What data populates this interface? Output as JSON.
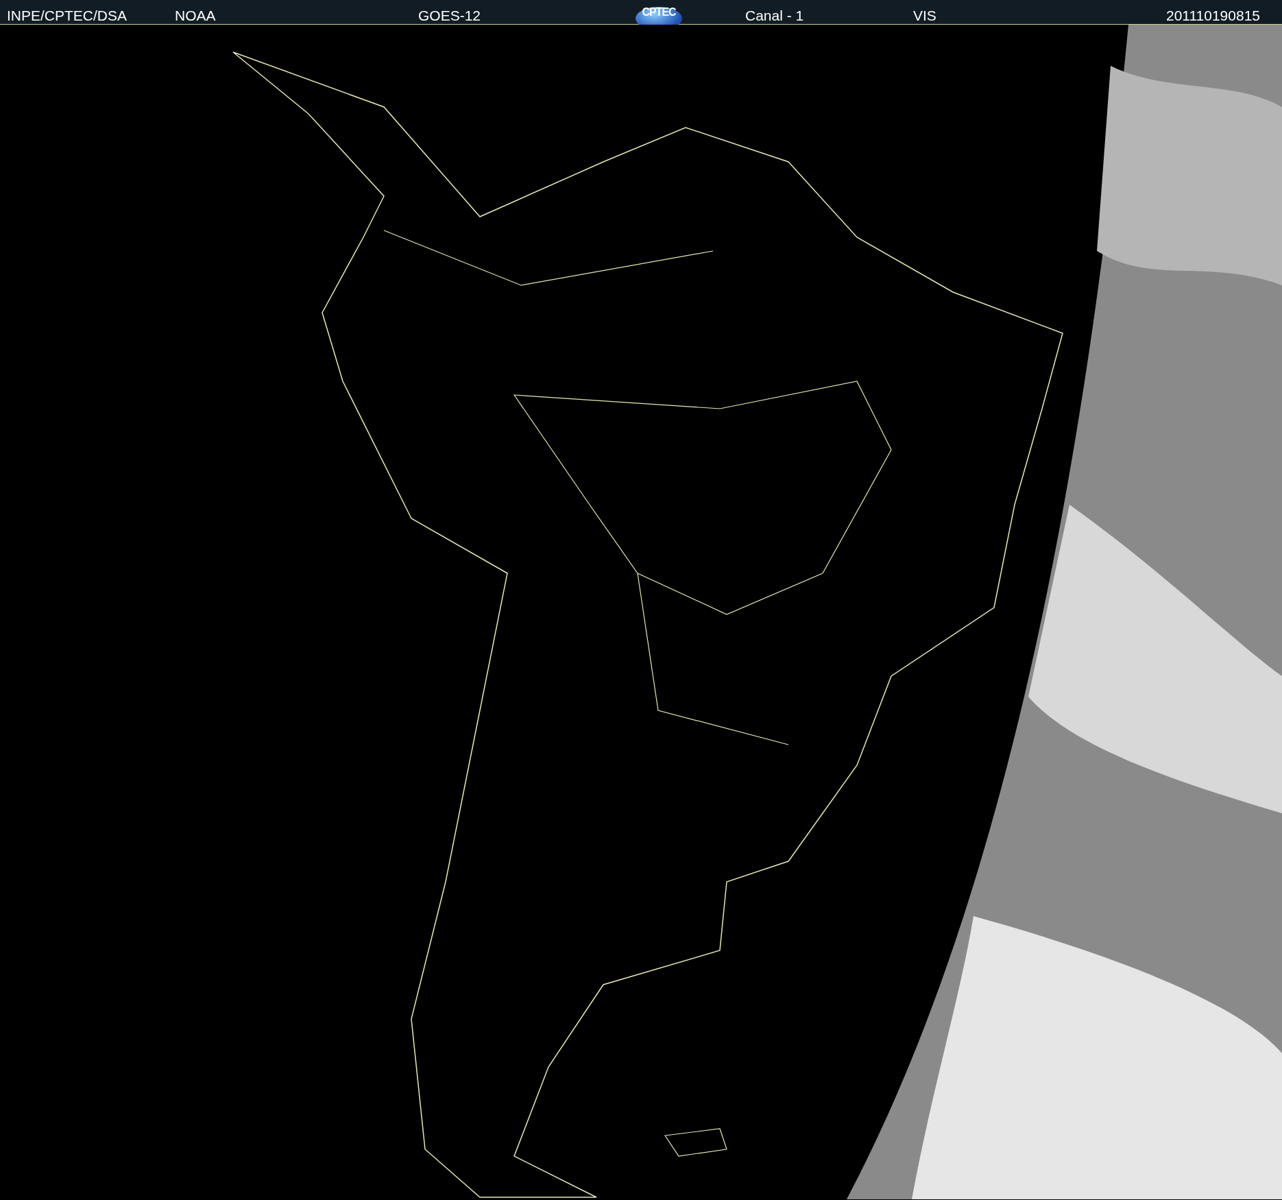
{
  "header": {
    "source": "INPE/CPTEC/DSA",
    "agency": "NOAA",
    "satellite": "GOES-12",
    "logo": "CPTEC",
    "channel": "Canal - 1",
    "band": "VIS",
    "timestamp": "201110190815"
  }
}
